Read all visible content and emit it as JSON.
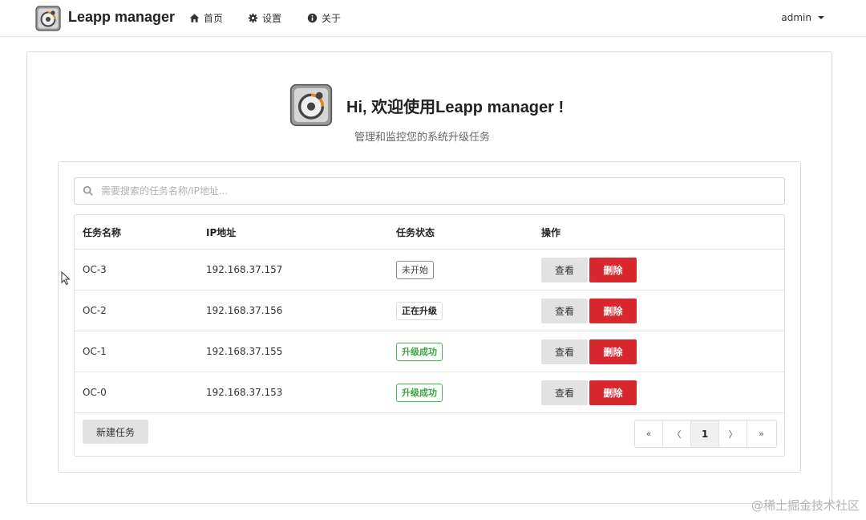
{
  "brand": {
    "name": "Leapp manager",
    "logo_icon": "disk-gear-icon"
  },
  "nav": {
    "items": [
      {
        "label": "首页",
        "icon": "home-icon"
      },
      {
        "label": "设置",
        "icon": "gear-icon"
      },
      {
        "label": "关于",
        "icon": "info-icon"
      }
    ],
    "user": "admin"
  },
  "hero": {
    "title": "Hi, 欢迎使用Leapp manager !",
    "subtitle": "管理和监控您的系统升级任务"
  },
  "search": {
    "placeholder": "需要搜索的任务名称/IP地址...",
    "value": ""
  },
  "table": {
    "headers": [
      "任务名称",
      "IP地址",
      "任务状态",
      "操作"
    ],
    "rows": [
      {
        "name": "OC-3",
        "ip": "192.168.37.157",
        "status": "未开始",
        "status_kind": "pending"
      },
      {
        "name": "OC-2",
        "ip": "192.168.37.156",
        "status": "正在升级",
        "status_kind": "running"
      },
      {
        "name": "OC-1",
        "ip": "192.168.37.155",
        "status": "升级成功",
        "status_kind": "success"
      },
      {
        "name": "OC-0",
        "ip": "192.168.37.153",
        "status": "升级成功",
        "status_kind": "success"
      }
    ],
    "view_label": "查看",
    "delete_label": "删除"
  },
  "footer": {
    "new_task_label": "新建任务",
    "pagination": {
      "first": "«",
      "prev": "〈",
      "current": "1",
      "next": "〉",
      "last": "»"
    }
  },
  "watermark": "@稀土掘金技术社区",
  "colors": {
    "danger": "#d9272e",
    "success": "#3aa53f",
    "muted_button": "#e2e2e2"
  }
}
